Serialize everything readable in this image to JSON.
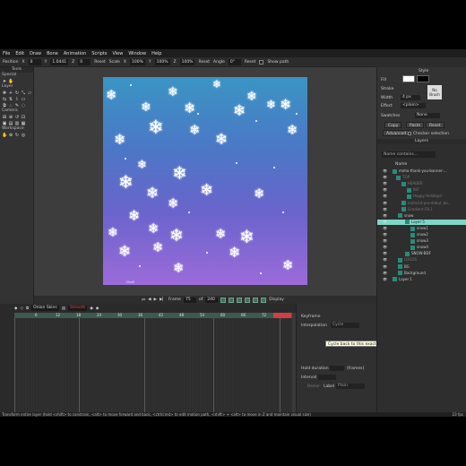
{
  "menu": [
    "File",
    "Edit",
    "Draw",
    "Bone",
    "Animation",
    "Scripts",
    "View",
    "Window",
    "Help"
  ],
  "tool_options": {
    "position_label": "Position",
    "x_label": "X",
    "x_value": "0",
    "y_label": "Y",
    "y_value": "1.0441",
    "z_label": "Z",
    "z_value": "0",
    "reset1": "Reset",
    "scale_label": "Scale",
    "scale_x_label": "X",
    "scale_x": "100%",
    "scale_y_label": "Y",
    "scale_y": "100%",
    "scale_z_label": "Z",
    "scale_z": "100%",
    "reset2": "Reset",
    "angle_label": "Angle",
    "angle_value": "0°",
    "reset3": "Reset",
    "show_path": "Show path"
  },
  "tools": {
    "title": "Tools",
    "groups": [
      "Special",
      "Layer",
      "Camera",
      "Workspace"
    ]
  },
  "canvas": {
    "signature": "Dish",
    "frame_label": "Frame",
    "frame_value": "75",
    "of_label": "of",
    "total_frames": "240",
    "display_label": "Display"
  },
  "timeline": {
    "onion_label": "Onion Skins",
    "smooth_label": "Smooth",
    "ruler_ticks": [
      "6",
      "12",
      "18",
      "24",
      "30",
      "36",
      "42",
      "48",
      "54",
      "60",
      "66",
      "72",
      "78"
    ]
  },
  "keyframe_panel": {
    "title": "Keyframe",
    "interpolation_label": "Interpolation",
    "interpolation_value": "Cycle",
    "tooltip": "Cycle back to this exact frame",
    "hold_label": "Hold duration",
    "hold_unit": "(frames)",
    "interval_label": "Interval",
    "bezier_label": "Bezier",
    "label_label": "Label",
    "label_value": "Plain"
  },
  "style_panel": {
    "title": "Style",
    "fill_label": "Fill",
    "stroke_label": "Stroke",
    "width_label": "Width",
    "width_value": "4 px",
    "brush_label": "No Brush",
    "effect_label": "Effect",
    "effect_value": "<plain>",
    "swatches_label": "Swatches",
    "swatches_value": "None",
    "copy_label": "Copy",
    "paste_label": "Paste",
    "reset_label": "Reset",
    "advanced_label": "Advanced",
    "checker_label": "Checker selection",
    "fill_color": "#ffffff",
    "stroke_color": "#000000"
  },
  "layers": {
    "title": "Layers",
    "filter_placeholder": "Name contains...",
    "name_header": "Name",
    "rows": [
      {
        "name": "moho-thank-you-banner-…",
        "selected": false,
        "dim": false,
        "indent": 24
      },
      {
        "name": "TOP",
        "selected": false,
        "dim": true,
        "indent": 28
      },
      {
        "name": "HEADER",
        "selected": false,
        "dim": true,
        "indent": 34
      },
      {
        "name": "BLT",
        "selected": false,
        "dim": true,
        "indent": 40
      },
      {
        "name": "Happy Holidays!",
        "selected": false,
        "dim": true,
        "indent": 40
      },
      {
        "name": "moho14-pro-debut_ba…",
        "selected": false,
        "dim": true,
        "indent": 34
      },
      {
        "name": "Gradient Fill 1",
        "selected": false,
        "dim": true,
        "indent": 34
      },
      {
        "name": "snow",
        "selected": false,
        "dim": false,
        "indent": 30
      },
      {
        "name": "Layer 5",
        "selected": true,
        "dim": false,
        "indent": 38
      },
      {
        "name": "snow1",
        "selected": false,
        "dim": false,
        "indent": 44
      },
      {
        "name": "snow2",
        "selected": false,
        "dim": false,
        "indent": 44
      },
      {
        "name": "snow3",
        "selected": false,
        "dim": false,
        "indent": 44
      },
      {
        "name": "snow4",
        "selected": false,
        "dim": false,
        "indent": 44
      },
      {
        "name": "SNOW-BDF",
        "selected": false,
        "dim": false,
        "indent": 38
      },
      {
        "name": "LOGOS",
        "selected": false,
        "dim": true,
        "indent": 30
      },
      {
        "name": "BG",
        "selected": false,
        "dim": false,
        "indent": 30
      },
      {
        "name": "Background",
        "selected": false,
        "dim": false,
        "indent": 30
      },
      {
        "name": "Layer 1",
        "selected": false,
        "dim": false,
        "indent": 24
      }
    ]
  },
  "status": {
    "hint": "Transform entire layer (hold <shift> to constrain, <alt> to move forward and back, <ctrl/cmd> to edit motion path, <shift> + <alt> to move in Z and maintain visual size)",
    "fps": "23 fps"
  }
}
